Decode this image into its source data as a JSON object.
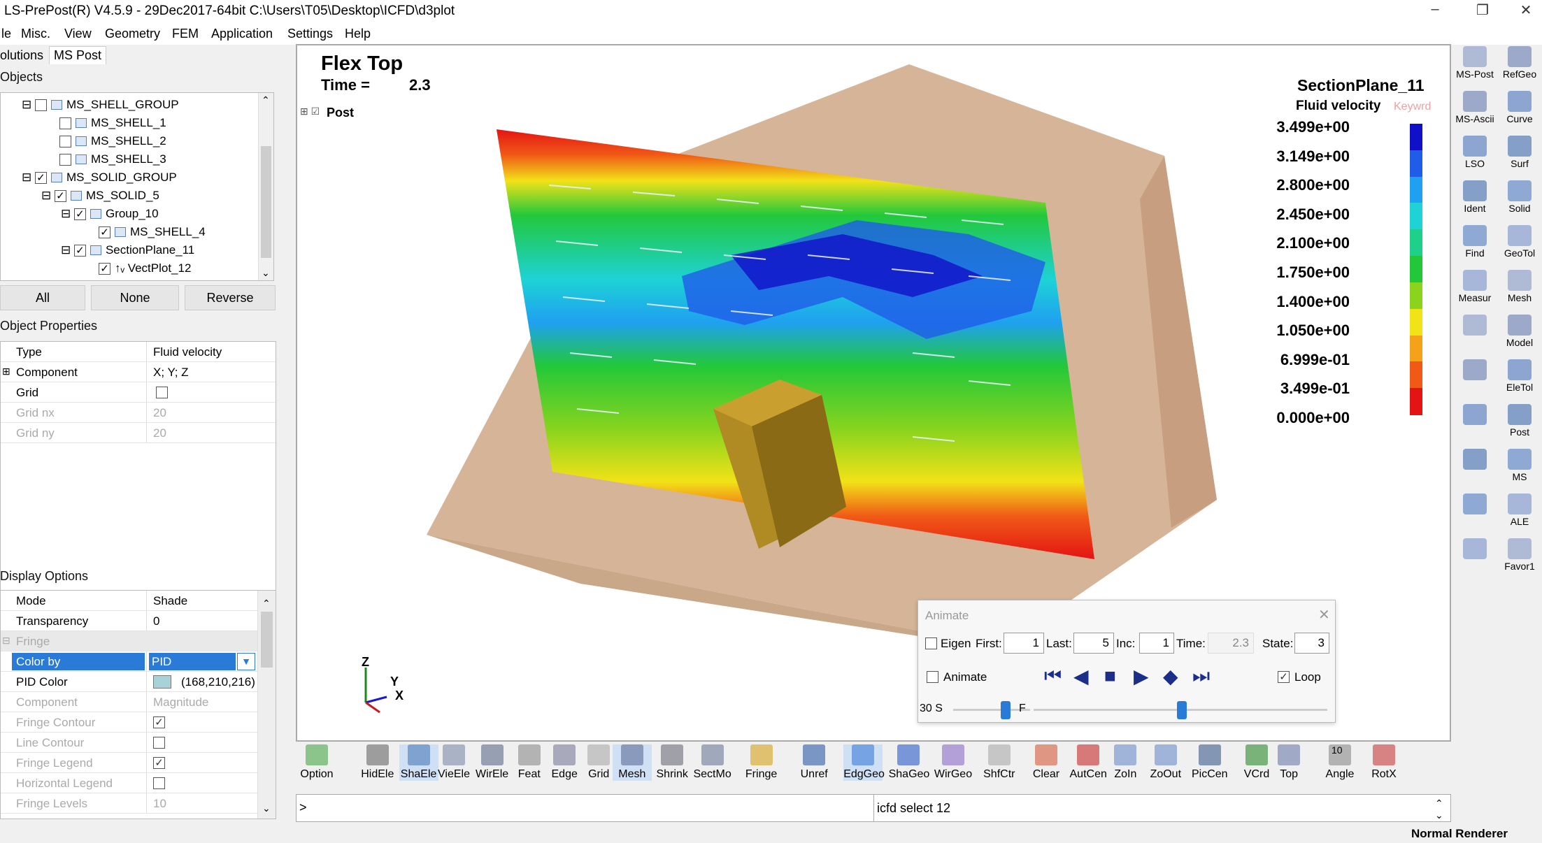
{
  "window": {
    "title": "LS-PrePost(R) V4.5.9 - 29Dec2017-64bit C:\\Users\\T05\\Desktop\\ICFD\\d3plot",
    "min": "–",
    "max": "❐",
    "close": "✕"
  },
  "menu": [
    "le",
    "Misc.",
    "View",
    "Geometry",
    "FEM",
    "Application",
    "Settings",
    "Help"
  ],
  "left_tabs": [
    "olutions",
    "MS Post"
  ],
  "objects_label": "Objects",
  "tree": [
    {
      "label": "MS_SHELL_GROUP",
      "checked": false
    },
    {
      "label": "MS_SHELL_1",
      "checked": false
    },
    {
      "label": "MS_SHELL_2",
      "checked": false
    },
    {
      "label": "MS_SHELL_3",
      "checked": false
    },
    {
      "label": "MS_SOLID_GROUP",
      "checked": true
    },
    {
      "label": "MS_SOLID_5",
      "checked": true
    },
    {
      "label": "Group_10",
      "checked": true
    },
    {
      "label": "MS_SHELL_4",
      "checked": true
    },
    {
      "label": "SectionPlane_11",
      "checked": true
    },
    {
      "label": "VectPlot_12",
      "checked": true
    }
  ],
  "select_buttons": [
    "All",
    "None",
    "Reverse"
  ],
  "object_props_label": "Object Properties",
  "object_props": [
    {
      "k": "Type",
      "v": "Fluid velocity",
      "dim": false
    },
    {
      "k": "Component",
      "v": "X; Y; Z",
      "dim": false
    },
    {
      "k": "Grid",
      "v": "",
      "dim": false
    },
    {
      "k": "Grid nx",
      "v": "20",
      "dim": true
    },
    {
      "k": "Grid ny",
      "v": "20",
      "dim": true
    }
  ],
  "display_options_label": "Display Options",
  "display_opts": [
    {
      "k": "Mode",
      "v": "Shade"
    },
    {
      "k": "Transparency",
      "v": "0"
    },
    {
      "k": "Fringe",
      "v": ""
    },
    {
      "k": "Color by",
      "v": "PID"
    },
    {
      "k": "PID Color",
      "v": "(168,210,216)"
    },
    {
      "k": "Component",
      "v": "Magnitude"
    },
    {
      "k": "Fringe Contour",
      "v": ""
    },
    {
      "k": "Line Contour",
      "v": ""
    },
    {
      "k": "Fringe Legend",
      "v": ""
    },
    {
      "k": "Horizontal Legend",
      "v": ""
    },
    {
      "k": "Fringe Levels",
      "v": "10"
    }
  ],
  "viewport": {
    "title": "Flex Top",
    "time_label": "Time =",
    "time_value": "2.3",
    "post_label": "Post",
    "legend_title": "SectionPlane_11",
    "legend_subtitle": "Fluid velocity",
    "legend_keyword": "Keywrd",
    "legend_values": [
      "3.499e+00",
      "3.149e+00",
      "2.800e+00",
      "2.450e+00",
      "2.100e+00",
      "1.750e+00",
      "1.400e+00",
      "1.050e+00",
      "6.999e-01",
      "3.499e-01",
      "0.000e+00"
    ],
    "legend_colors": [
      "#1010c8",
      "#1f5ce8",
      "#1fa0f0",
      "#1ed2d6",
      "#1ed08a",
      "#22c83a",
      "#8ad41e",
      "#f2e218",
      "#f5a21a",
      "#f05a16",
      "#e41414"
    ],
    "axis": {
      "z": "Z",
      "y": "Y",
      "x": "X"
    }
  },
  "animate": {
    "title": "Animate",
    "eigen": "Eigen",
    "first_label": "First:",
    "first": "1",
    "last_label": "Last:",
    "last": "5",
    "inc_label": "Inc:",
    "inc": "1",
    "time_label": "Time:",
    "time": "2.3",
    "state_label": "State:",
    "state": "3",
    "animate": "Animate",
    "loop": "Loop",
    "speed_label": "30 S",
    "f_label": "F"
  },
  "right_tools": [
    [
      "MS-Post",
      "RefGeo"
    ],
    [
      "MS-Ascii",
      "Curve"
    ],
    [
      "LSO",
      "Surf"
    ],
    [
      "Ident",
      "Solid"
    ],
    [
      "Find",
      "GeoTol"
    ],
    [
      "Measur",
      "Mesh"
    ],
    [
      "",
      "Model"
    ],
    [
      "",
      "EleTol"
    ],
    [
      "",
      "Post"
    ],
    [
      "",
      "MS"
    ],
    [
      "",
      "ALE"
    ],
    [
      "",
      "Favor1"
    ]
  ],
  "bottom_tools": [
    "Option",
    "HidEle",
    "ShaEle",
    "VieEle",
    "WirEle",
    "Feat",
    "Edge",
    "Grid",
    "Mesh",
    "Shrink",
    "SectMo",
    "Fringe",
    "Unref",
    "EdgGeo",
    "ShaGeo",
    "WirGeo",
    "ShfCtr",
    "Clear",
    "AutCen",
    "ZoIn",
    "ZoOut",
    "PicCen",
    "VCrd",
    "Top",
    "Angle",
    "RotX"
  ],
  "angle_value": "10",
  "command": {
    "prompt": ">",
    "text": "icfd select 12"
  },
  "status": "Normal Renderer"
}
